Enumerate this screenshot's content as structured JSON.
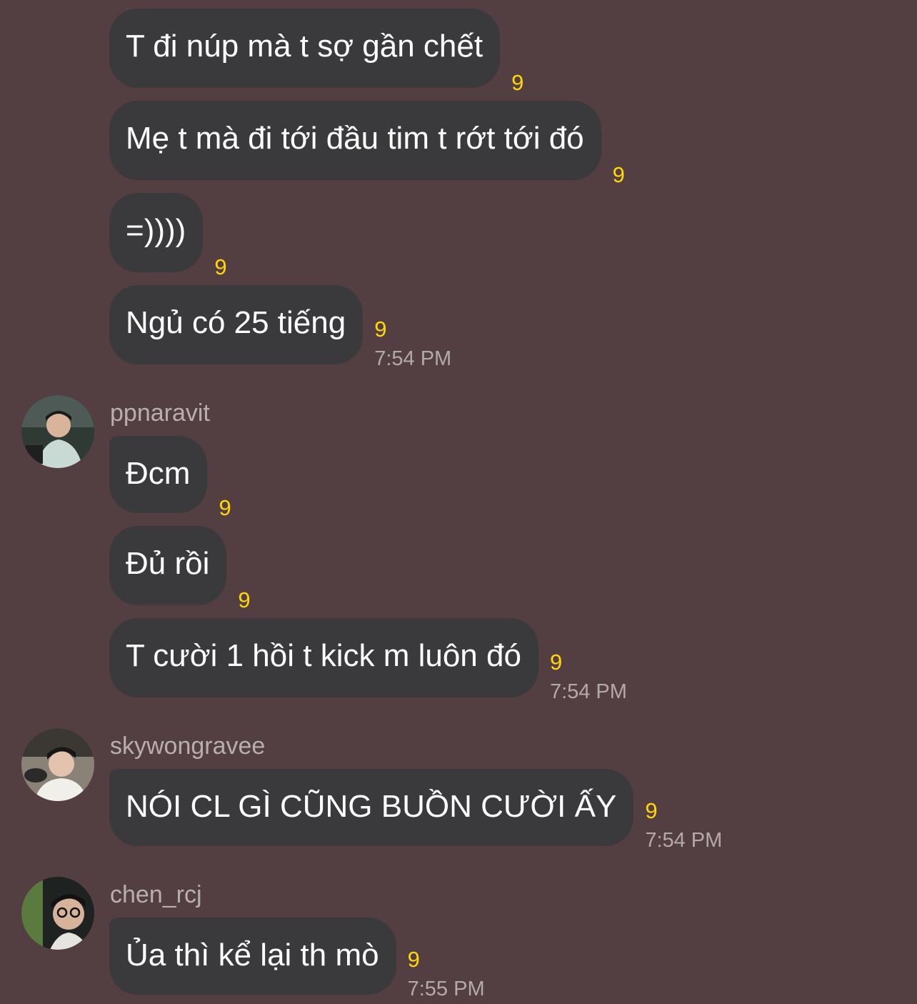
{
  "messages": [
    {
      "text": "T đi núp mà t sợ gần chết",
      "count": "9",
      "time": ""
    },
    {
      "text": "Mẹ t mà đi tới đầu tim t rớt tới đó",
      "count": "9",
      "time": ""
    },
    {
      "text": "=))))",
      "count": "9",
      "time": ""
    },
    {
      "text": "Ngủ có 25 tiếng",
      "count": "9",
      "time": "7:54 PM"
    },
    {
      "text": "Đcm",
      "count": "9",
      "time": ""
    },
    {
      "text": "Đủ rồi",
      "count": "9",
      "time": ""
    },
    {
      "text": "T cười 1 hồi t kick m luôn đó",
      "count": "9",
      "time": "7:54 PM"
    },
    {
      "text": "NÓI CL GÌ CŨNG BUỒN CƯỜI ẤY",
      "count": "9",
      "time": "7:54 PM"
    },
    {
      "text": "Ủa thì kể lại th mò",
      "count": "9",
      "time": "7:55 PM"
    }
  ],
  "senders": {
    "ppnaravit": "ppnaravit",
    "skywongravee": "skywongravee",
    "chen_rcj": "chen_rcj"
  },
  "colors": {
    "background": "#533f41",
    "bubble": "#3a3a3c",
    "count": "#ffd60a",
    "timestamp": "#b4a9aa"
  }
}
